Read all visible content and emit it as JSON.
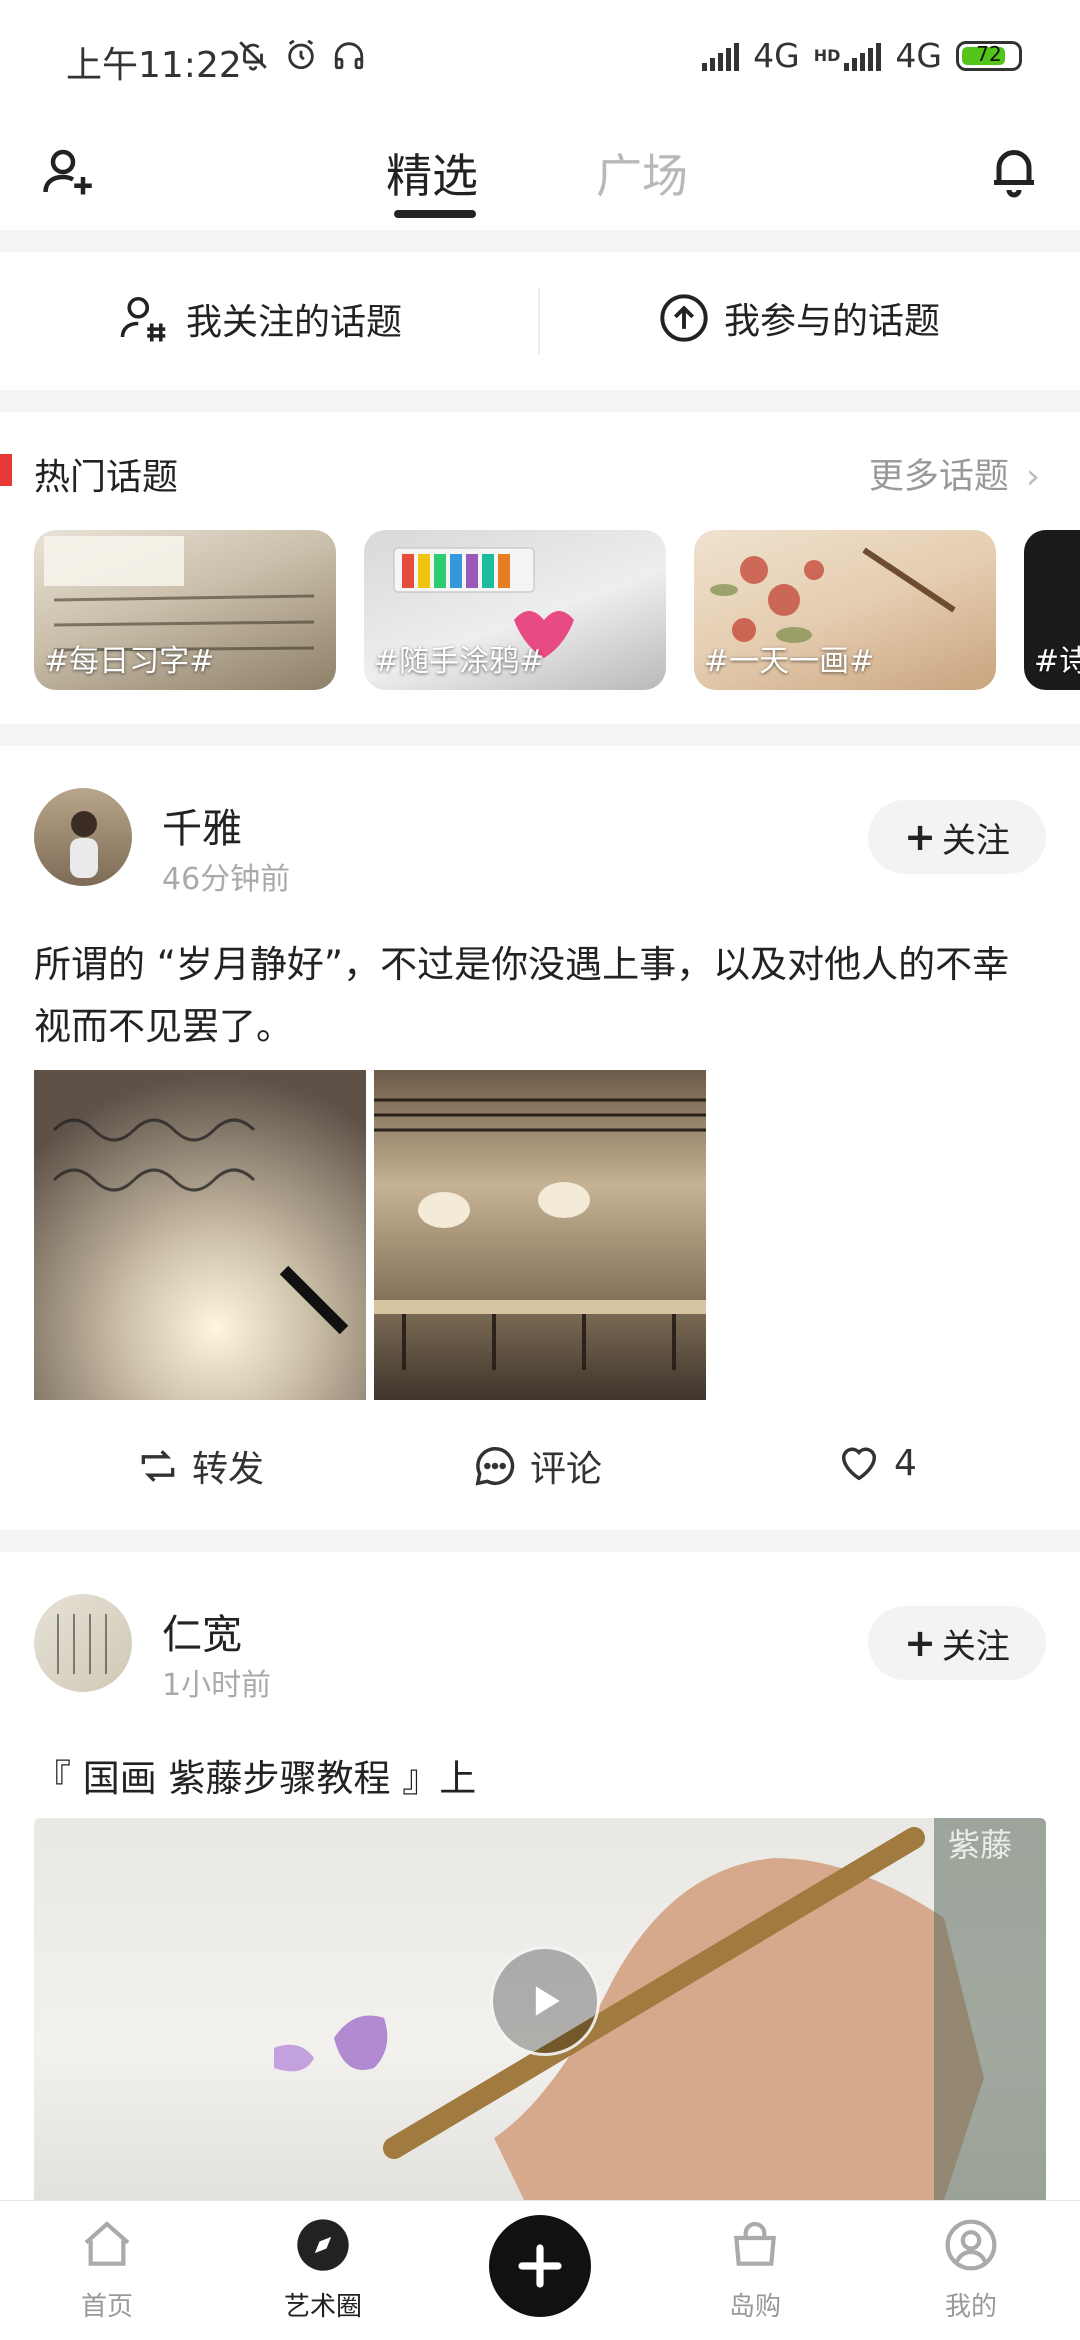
{
  "status_bar": {
    "time": "上午11:22",
    "network_1": "4G",
    "network_2": "4G",
    "hd_badge": "HD",
    "battery_level": "72"
  },
  "header": {
    "tabs": [
      {
        "label": "精选",
        "active": true
      },
      {
        "label": "广场",
        "active": false
      }
    ],
    "left_icon": "add-user-icon",
    "right_icon": "bell-icon"
  },
  "topic_shortcuts": [
    {
      "label": "我关注的话题",
      "icon": "user-hash-icon"
    },
    {
      "label": "我参与的话题",
      "icon": "arrow-up-circle-icon"
    }
  ],
  "hot_topics": {
    "title": "热门话题",
    "more": "更多话题",
    "cards": [
      {
        "label": "#每日习字#"
      },
      {
        "label": "#随手涂鸦#"
      },
      {
        "label": "#一天一画#"
      },
      {
        "label": "#诗"
      }
    ]
  },
  "posts": [
    {
      "author": "千雅",
      "time": "46分钟前",
      "follow_label": "关注",
      "text": "所谓的 “岁月静好”，不过是你没遇上事，以及对他人的不幸视而不见罢了。",
      "actions": {
        "repost": "转发",
        "comment": "评论",
        "likes": "4"
      }
    },
    {
      "author": "仁宽",
      "time": "1小时前",
      "follow_label": "关注",
      "text": "『 国画 紫藤步骤教程 』上",
      "video_watermark": "紫藤"
    }
  ],
  "bottom_nav": [
    {
      "label": "首页",
      "icon": "home-icon",
      "active": false
    },
    {
      "label": "艺术圈",
      "icon": "compass-icon",
      "active": true
    },
    {
      "label": "",
      "icon": "plus-icon",
      "active": false
    },
    {
      "label": "岛购",
      "icon": "shop-icon",
      "active": false
    },
    {
      "label": "我的",
      "icon": "profile-icon",
      "active": false
    }
  ],
  "colors": {
    "accent_red": "#e53935",
    "battery_green": "#52c41a",
    "inactive_tab": "#b8b8b8"
  }
}
